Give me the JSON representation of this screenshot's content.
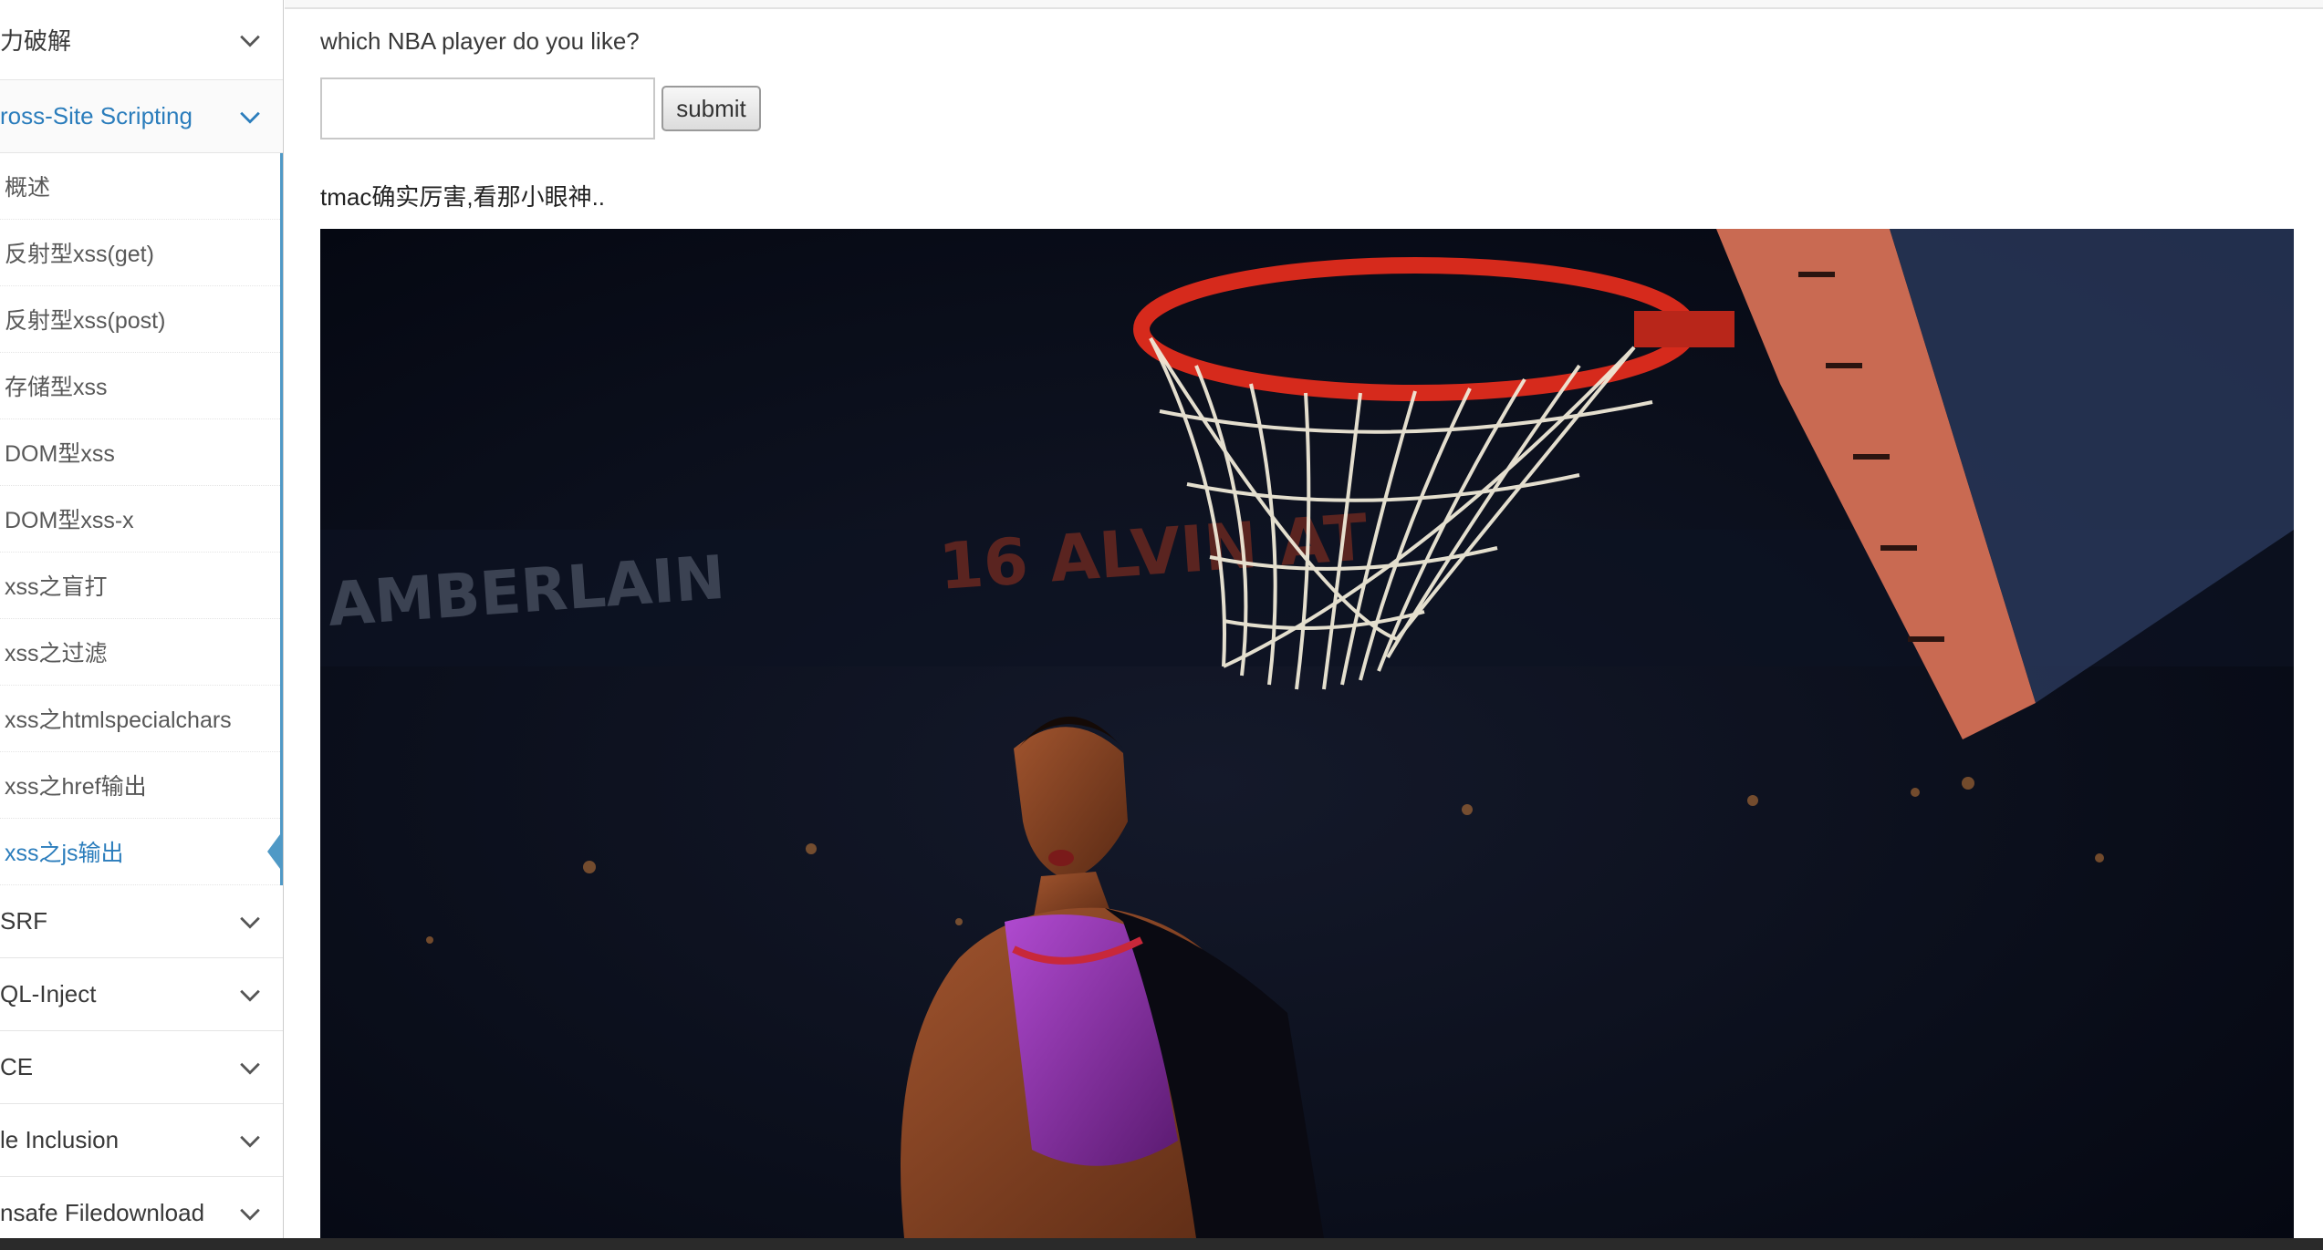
{
  "sidebar": {
    "groups_top": [
      {
        "label": "力破解",
        "open": false
      }
    ],
    "xss_group": {
      "label": "ross-Site Scripting",
      "open": true
    },
    "xss_items": [
      {
        "label": "概述"
      },
      {
        "label": "反射型xss(get)"
      },
      {
        "label": "反射型xss(post)"
      },
      {
        "label": "存储型xss"
      },
      {
        "label": "DOM型xss"
      },
      {
        "label": "DOM型xss-x"
      },
      {
        "label": "xss之盲打"
      },
      {
        "label": "xss之过滤"
      },
      {
        "label": "xss之htmlspecialchars"
      },
      {
        "label": "xss之href输出"
      },
      {
        "label": "xss之js输出",
        "active": true
      }
    ],
    "groups_bottom": [
      {
        "label": "SRF"
      },
      {
        "label": "QL-Inject"
      },
      {
        "label": "CE"
      },
      {
        "label": "le Inclusion"
      },
      {
        "label": "nsafe Filedownload"
      }
    ]
  },
  "main": {
    "question": "which NBA player do you like?",
    "input_value": "",
    "submit_label": "submit",
    "result_message": "tmac确实厉害,看那小眼神..",
    "photo": {
      "arena_text_left": "AMBERLAIN",
      "arena_text_mid": "16 ALVIN AT"
    }
  },
  "colors": {
    "accent": "#2b7dbc",
    "submenu_border": "#4f99c6",
    "text": "#393939",
    "photo_bg": "#050914",
    "rim": "#d62a1c"
  },
  "icons": {
    "chevron": "chevron-down-icon"
  }
}
